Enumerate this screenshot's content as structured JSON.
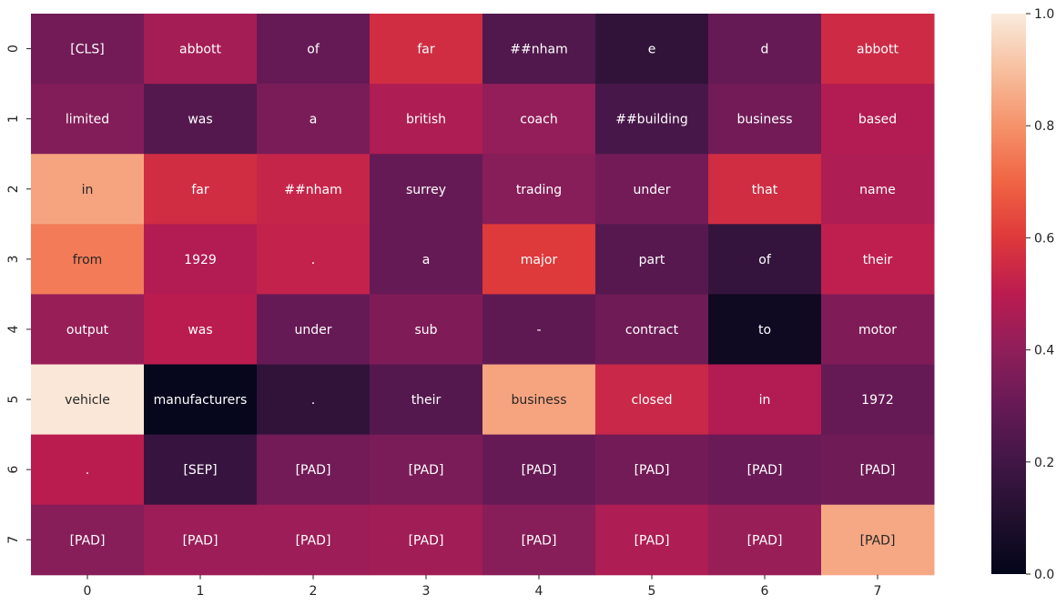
{
  "chart_data": {
    "type": "heatmap",
    "title": "",
    "xlabel": "",
    "ylabel": "",
    "x_ticks": [
      "0",
      "1",
      "2",
      "3",
      "4",
      "5",
      "6",
      "7"
    ],
    "y_ticks": [
      "0",
      "1",
      "2",
      "3",
      "4",
      "5",
      "6",
      "7"
    ],
    "colorbar": {
      "range": [
        0.0,
        1.0
      ],
      "ticks": [
        "0.0",
        "0.2",
        "0.4",
        "0.6",
        "0.8",
        "1.0"
      ],
      "colormap": "rocket"
    },
    "labels": [
      [
        "[CLS]",
        "abbott",
        "of",
        "far",
        "##nham",
        "e",
        "d",
        "abbott"
      ],
      [
        "limited",
        "was",
        "a",
        "british",
        "coach",
        "##building",
        "business",
        "based"
      ],
      [
        "in",
        "far",
        "##nham",
        "surrey",
        "trading",
        "under",
        "that",
        "name"
      ],
      [
        "from",
        "1929",
        ".",
        "a",
        "major",
        "part",
        "of",
        "their"
      ],
      [
        "output",
        "was",
        "under",
        "sub",
        "-",
        "contract",
        "to",
        "motor"
      ],
      [
        "vehicle",
        "manufacturers",
        ".",
        "their",
        "business",
        "closed",
        "in",
        "1972"
      ],
      [
        ".",
        "[SEP]",
        "[PAD]",
        "[PAD]",
        "[PAD]",
        "[PAD]",
        "[PAD]",
        "[PAD]"
      ],
      [
        "[PAD]",
        "[PAD]",
        "[PAD]",
        "[PAD]",
        "[PAD]",
        "[PAD]",
        "[PAD]",
        "[PAD]"
      ]
    ],
    "values": [
      [
        0.33,
        0.45,
        0.3,
        0.56,
        0.24,
        0.15,
        0.3,
        0.55
      ],
      [
        0.37,
        0.25,
        0.35,
        0.47,
        0.41,
        0.22,
        0.33,
        0.48
      ],
      [
        0.84,
        0.56,
        0.53,
        0.3,
        0.38,
        0.33,
        0.56,
        0.47
      ],
      [
        0.75,
        0.48,
        0.52,
        0.3,
        0.6,
        0.26,
        0.16,
        0.51
      ],
      [
        0.42,
        0.5,
        0.3,
        0.36,
        0.28,
        0.32,
        0.04,
        0.36
      ],
      [
        0.99,
        0.01,
        0.15,
        0.25,
        0.84,
        0.54,
        0.48,
        0.3
      ],
      [
        0.5,
        0.17,
        0.33,
        0.35,
        0.3,
        0.33,
        0.31,
        0.32
      ],
      [
        0.38,
        0.43,
        0.43,
        0.44,
        0.38,
        0.47,
        0.42,
        0.85
      ]
    ]
  }
}
